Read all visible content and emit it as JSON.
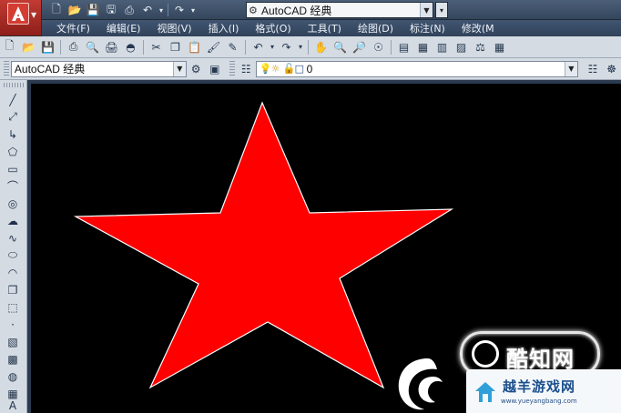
{
  "titlebar": {
    "workspace": "AutoCAD 经典",
    "icons": [
      "new-icon",
      "open-icon",
      "save-icon",
      "save-as-icon",
      "print-icon",
      "undo-icon",
      "redo-icon"
    ]
  },
  "menubar": {
    "items": [
      "文件(F)",
      "编辑(E)",
      "视图(V)",
      "插入(I)",
      "格式(O)",
      "工具(T)",
      "绘图(D)",
      "标注(N)",
      "修改(M"
    ]
  },
  "layerbar": {
    "workspace": "AutoCAD 经典",
    "layer_name": "0"
  },
  "drawing": {
    "fill_color": "#ff0000",
    "outline_color": "#ffffff",
    "background": "#000000"
  },
  "watermark": {
    "ring_text": "酷知网",
    "title": "越羊游戏网",
    "url": "www.yueyangbang.com"
  },
  "colors": {
    "accent": "#c23a33",
    "title_bg": "#3d5068",
    "toolbar_bg": "#d4dbe3"
  }
}
